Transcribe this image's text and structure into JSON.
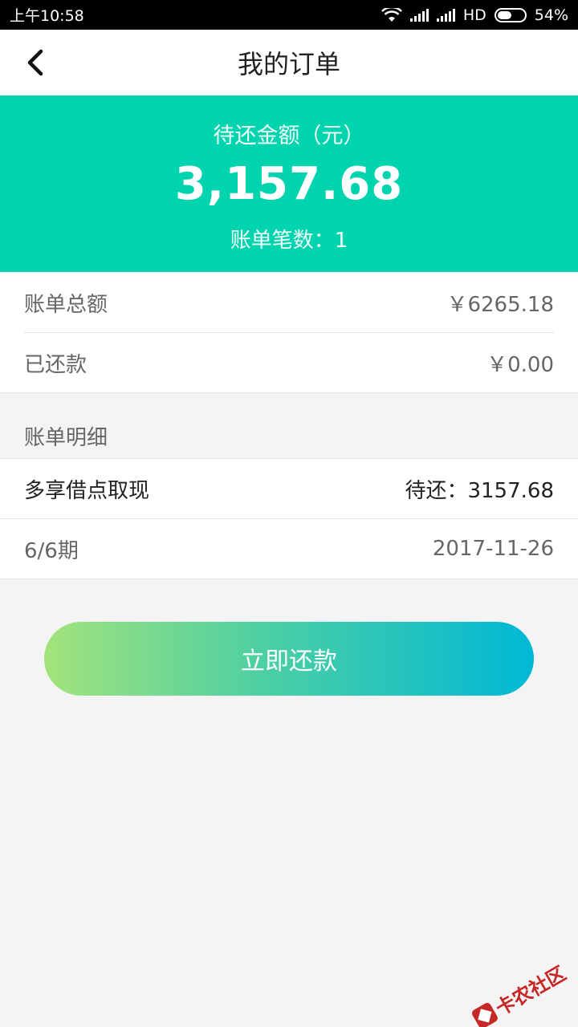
{
  "status_bar": {
    "time": "上午10:58",
    "network": "HD",
    "battery": "54%",
    "battery_level": 0.54
  },
  "nav": {
    "title": "我的订单"
  },
  "summary": {
    "label": "待还金额（元）",
    "amount": "3,157.68",
    "count_text": "账单笔数：1",
    "bg_color": "#00d4ae"
  },
  "totals": {
    "total_label": "账单总额",
    "total_value": "￥6265.18",
    "paid_label": "已还款",
    "paid_value": "￥0.00"
  },
  "detail": {
    "section_title": "账单明细",
    "product": "多享借点取现",
    "due_text": "待还：3157.68",
    "period": "6/6期",
    "date": "2017-11-26"
  },
  "action": {
    "pay_label": "立即还款"
  },
  "watermark": {
    "text": "卡农社区"
  }
}
